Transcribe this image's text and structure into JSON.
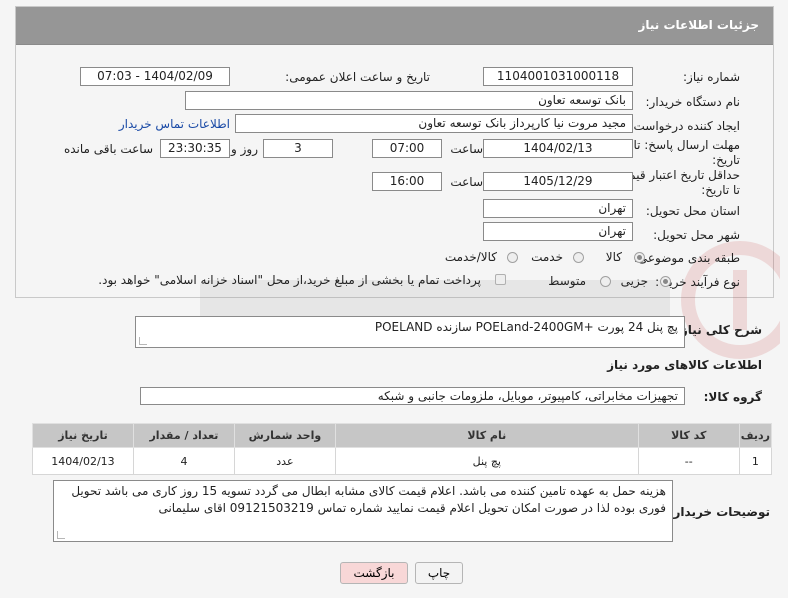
{
  "header": {
    "title": "جزئیات اطلاعات نیاز"
  },
  "fields": {
    "need_number_label": "شماره نیاز:",
    "need_number": "1104001031000118",
    "announce_label": "تاریخ و ساعت اعلان عمومی:",
    "announce_value": "1404/02/09 - 07:03",
    "buyer_org_label": "نام دستگاه خریدار:",
    "buyer_org": "بانک توسعه تعاون",
    "requester_label": "ایجاد کننده درخواست:",
    "requester": "مجید مروت نیا کارپرداز بانک توسعه تعاون",
    "contact_link": "اطلاعات تماس خریدار",
    "reply_deadline_label_1": "مهلت ارسال پاسخ: تا",
    "reply_deadline_label_2": "تاریخ:",
    "reply_date": "1404/02/13",
    "time_label": "ساعت",
    "reply_time": "07:00",
    "days_value": "3",
    "days_label": "روز و",
    "remaining_time": "23:30:35",
    "remaining_label": "ساعت باقی مانده",
    "price_validity_label_1": "حداقل تاریخ اعتبار قیمت:",
    "price_validity_label_2": "تا تاریخ:",
    "price_date": "1405/12/29",
    "price_time": "16:00",
    "province_label": "استان محل تحویل:",
    "province": "تهران",
    "city_label": "شهر محل تحویل:",
    "city": "تهران",
    "category_label": "طبقه بندی موضوعی:",
    "category_options": [
      "کالا",
      "خدمت",
      "کالا/خدمت"
    ],
    "category_selected": 0,
    "process_label": "نوع فرآیند خرید :",
    "process_options": [
      "جزیی",
      "متوسط"
    ],
    "process_selected": 0,
    "payment_note": "پرداخت تمام یا بخشی از مبلغ خرید،از محل \"اسناد خزانه اسلامی\" خواهد بود."
  },
  "description": {
    "label": "شرح کلی نیاز:",
    "value": "پچ پنل 24 پورت  +POELand-2400GM   سازنده POELAND"
  },
  "goods_section": {
    "title": "اطلاعات کالاهای مورد نیاز",
    "group_label": "گروه کالا:",
    "group_value": "تجهیزات مخابراتی، کامپیوتر، موبایل، ملزومات جانبی و شبکه"
  },
  "table": {
    "headers": [
      "ردیف",
      "کد کالا",
      "نام کالا",
      "واحد شمارش",
      "تعداد / مقدار",
      "تاریخ نیاز"
    ],
    "rows": [
      [
        "1",
        "--",
        "پچ پنل",
        "عدد",
        "4",
        "1404/02/13"
      ]
    ]
  },
  "buyer_notes": {
    "label": "توضیحات خریدار:",
    "value": "هزینه حمل به عهده تامین کننده می باشد. اعلام قیمت کالای مشابه ابطال می گردد تسویه 15 روز کاری می باشد تحویل فوری بوده لذا در صورت امکان تحویل اعلام قیمت نمایید شماره تماس 09121503219 اقای سلیمانی"
  },
  "buttons": {
    "print": "چاپ",
    "back": "بازگشت"
  },
  "colors": {
    "header_bg": "#969696",
    "link": "#1a4aa6",
    "back_button_bg": "#f8d7d7"
  }
}
